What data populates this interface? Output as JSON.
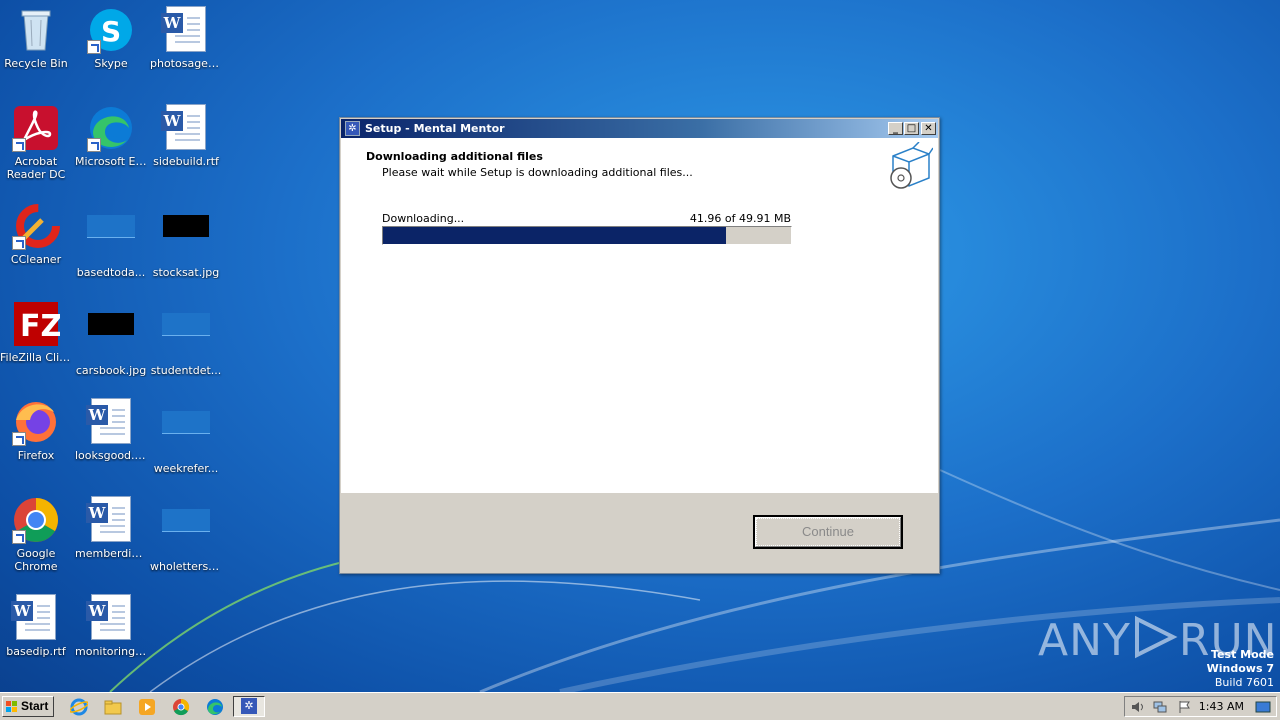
{
  "desktop": {
    "icons": [
      {
        "label": "Recycle Bin"
      },
      {
        "label": "Skype"
      },
      {
        "label": "photosagen..."
      },
      {
        "label": "Acrobat Reader DC"
      },
      {
        "label": "Microsoft Edge"
      },
      {
        "label": "sidebuild.rtf"
      },
      {
        "label": "CCleaner"
      },
      {
        "label": "basedtoda..."
      },
      {
        "label": "stocksat.jpg"
      },
      {
        "label": "FileZilla Client"
      },
      {
        "label": "carsbook.jpg"
      },
      {
        "label": "studentdet..."
      },
      {
        "label": "Firefox"
      },
      {
        "label": "looksgood.rtf"
      },
      {
        "label": "weekrefer..."
      },
      {
        "label": "Google Chrome"
      },
      {
        "label": "memberdiff..."
      },
      {
        "label": "wholetters...."
      },
      {
        "label": "basedip.rtf"
      },
      {
        "label": "monitorings..."
      }
    ]
  },
  "window": {
    "title": "Setup - Mental Mentor",
    "heading": "Downloading additional files",
    "subheading": "Please wait while Setup is downloading additional files...",
    "download_label": "Downloading...",
    "download_size": "41.96 of 49.91 MB",
    "progress_fraction": 0.8407,
    "continue_label": "Continue",
    "minimize_glyph": "_",
    "maximize_glyph": "□",
    "close_glyph": "✕"
  },
  "watermark": {
    "brand_left": "ANY",
    "brand_right": "RUN",
    "test_mode": "Test Mode",
    "os": "Windows 7",
    "build": "Build 7601"
  },
  "taskbar": {
    "start_label": "Start",
    "clock": "1:43 AM",
    "pinned": [
      "internet-explorer-icon",
      "file-explorer-icon",
      "media-player-icon",
      "chrome-icon",
      "edge-icon",
      "setup-app-icon"
    ]
  }
}
